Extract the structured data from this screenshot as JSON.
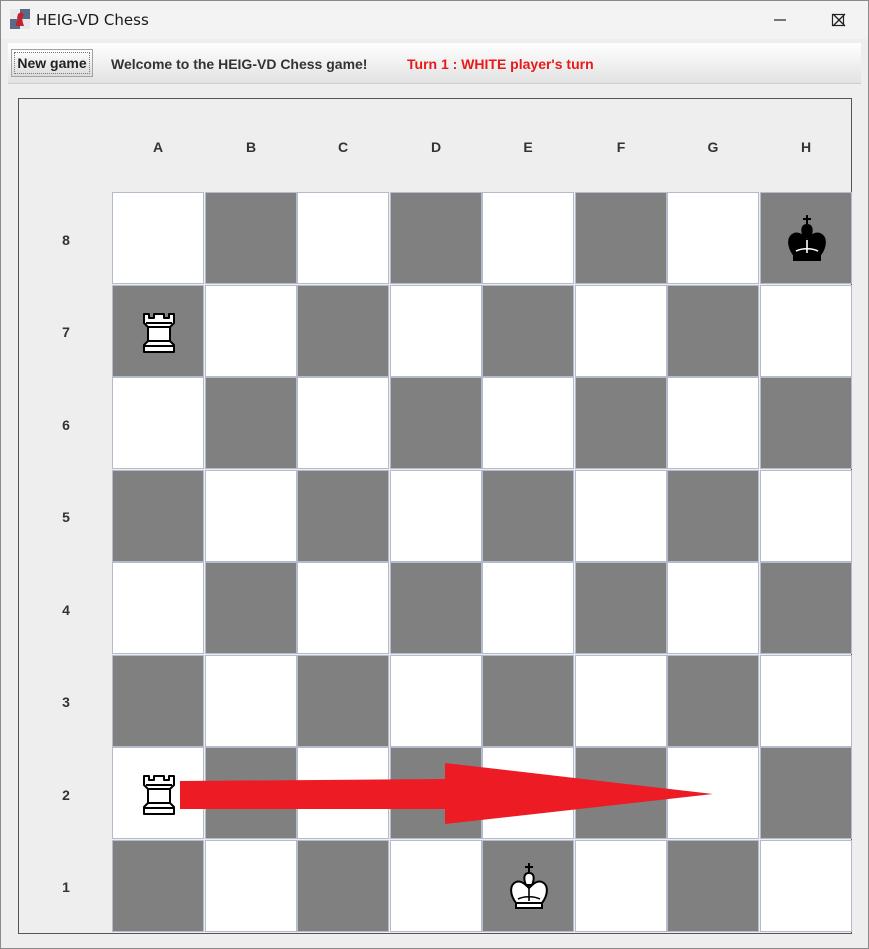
{
  "window": {
    "title": "HEIG-VD Chess",
    "controls": [
      "minimize-icon",
      "maximize-icon",
      "close-icon"
    ]
  },
  "toolbar": {
    "new_game_label": "New game",
    "welcome_text": "Welcome to the HEIG-VD Chess game!",
    "turn_text": "Turn 1 : WHITE player's turn",
    "turn_color": "#e81919"
  },
  "board": {
    "columns": [
      "A",
      "B",
      "C",
      "D",
      "E",
      "F",
      "G",
      "H"
    ],
    "rows": [
      "8",
      "7",
      "6",
      "5",
      "4",
      "3",
      "2",
      "1"
    ],
    "light_color": "#ffffff",
    "dark_color": "#808080",
    "pieces": [
      {
        "square": "H8",
        "color": "black",
        "type": "king",
        "icon": "black-king-icon"
      },
      {
        "square": "A7",
        "color": "white",
        "type": "rook",
        "icon": "white-rook-icon"
      },
      {
        "square": "A2",
        "color": "white",
        "type": "rook",
        "icon": "white-rook-icon"
      },
      {
        "square": "E1",
        "color": "white",
        "type": "king",
        "icon": "white-king-icon"
      }
    ],
    "annotation": {
      "type": "arrow",
      "from": "A2",
      "to": "G2",
      "color": "#ed1c24"
    }
  }
}
